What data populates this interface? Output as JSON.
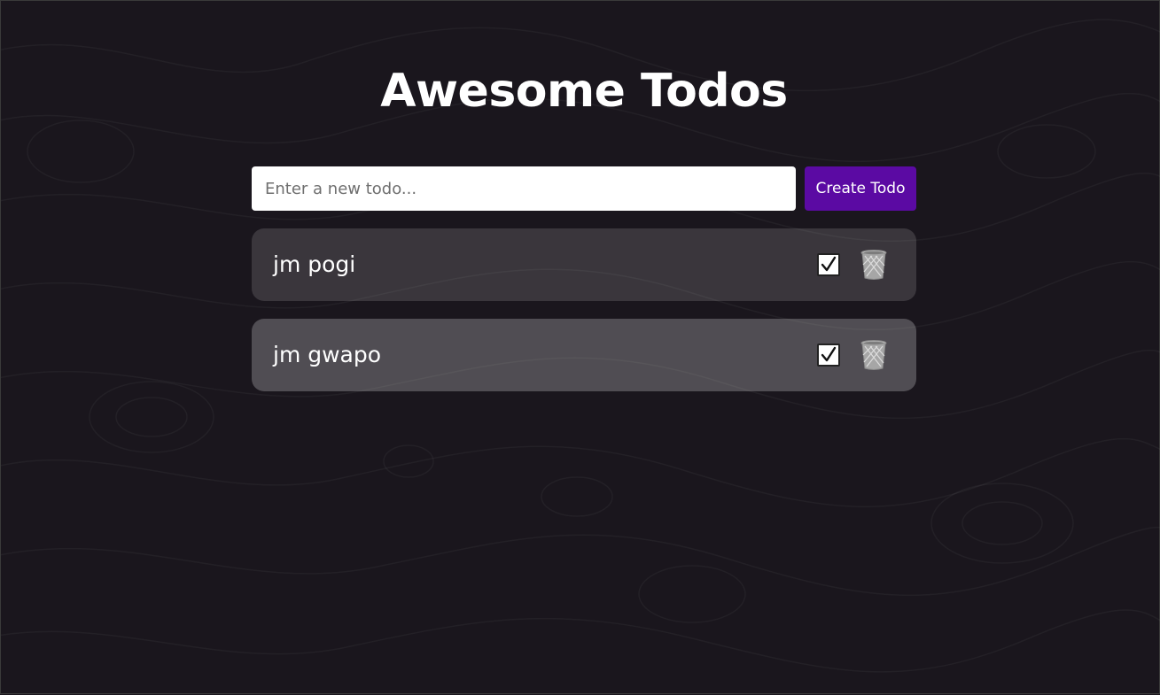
{
  "app": {
    "title": "Awesome Todos"
  },
  "form": {
    "input_placeholder": "Enter a new todo...",
    "input_value": "",
    "create_button_label": "Create Todo"
  },
  "todos": [
    {
      "text": "jm pogi",
      "check_icon": "checkbox-checked-icon",
      "delete_icon": "trash-icon"
    },
    {
      "text": "jm gwapo",
      "check_icon": "checkbox-checked-icon",
      "delete_icon": "trash-icon"
    }
  ],
  "colors": {
    "background": "#1a161d",
    "accent": "#5b0aa3",
    "text": "#ffffff"
  }
}
